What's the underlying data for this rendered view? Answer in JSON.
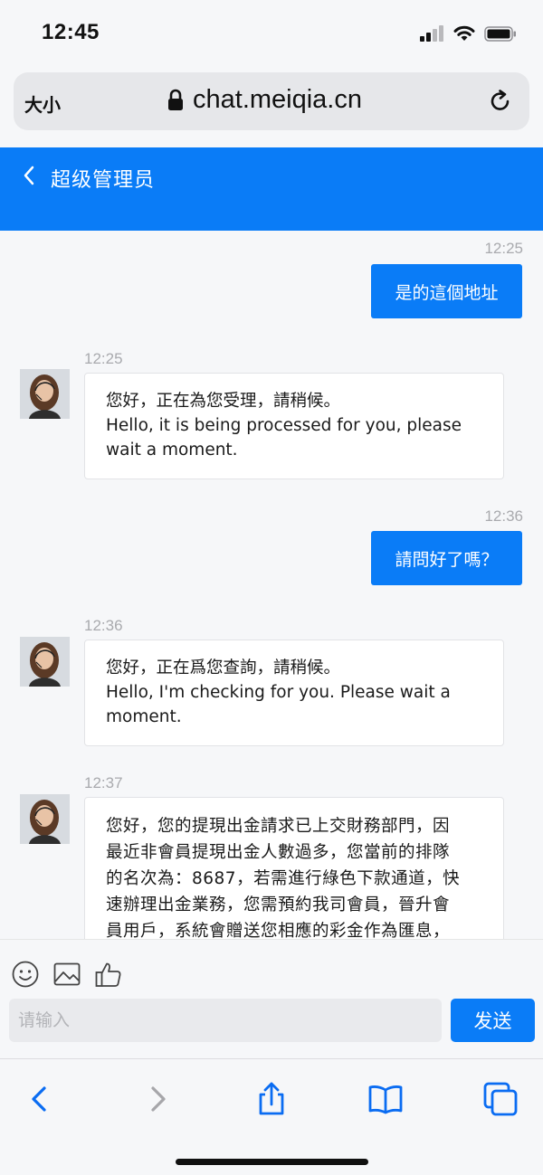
{
  "status_bar": {
    "time": "12:45"
  },
  "browser": {
    "text_size_label": "大小",
    "url": "chat.meiqia.cn"
  },
  "header": {
    "title": "超级管理员"
  },
  "messages": [
    {
      "direction": "out",
      "time": "12:25",
      "text": "是的這個地址"
    },
    {
      "direction": "in",
      "time": "12:25",
      "lines": [
        "您好，正在為您受理，請稍候。",
        "Hello, it is being processed for you, please",
        "wait a moment."
      ]
    },
    {
      "direction": "out",
      "time": "12:36",
      "text": "請問好了嗎？"
    },
    {
      "direction": "in",
      "time": "12:36",
      "lines": [
        "您好，正在爲您查詢，請稍候。",
        "Hello, I'm checking for you. Please wait a",
        "moment."
      ]
    },
    {
      "direction": "in",
      "time": "12:37",
      "lines": [
        "您好，您的提現出金請求已上交財務部門，因",
        "最近非會員提現出金人數過多，您當前的排隊",
        "的名次為：8687，若需進行綠色下款通道，快",
        "速辦理出金業務，您需預約我司會員，晉升會",
        "員用戶，系統會贈送您相應的彩金作為匯息，"
      ]
    }
  ],
  "composer": {
    "placeholder": "请输入",
    "send_label": "发送",
    "tools": [
      "emoji-icon",
      "image-icon",
      "thumbs-up-icon"
    ]
  },
  "toolbar": {
    "icons": [
      "back-icon",
      "forward-icon",
      "share-icon",
      "bookmarks-icon",
      "tabs-icon"
    ]
  },
  "colors": {
    "accent": "#0a7cf7",
    "background": "#f6f7f9"
  }
}
